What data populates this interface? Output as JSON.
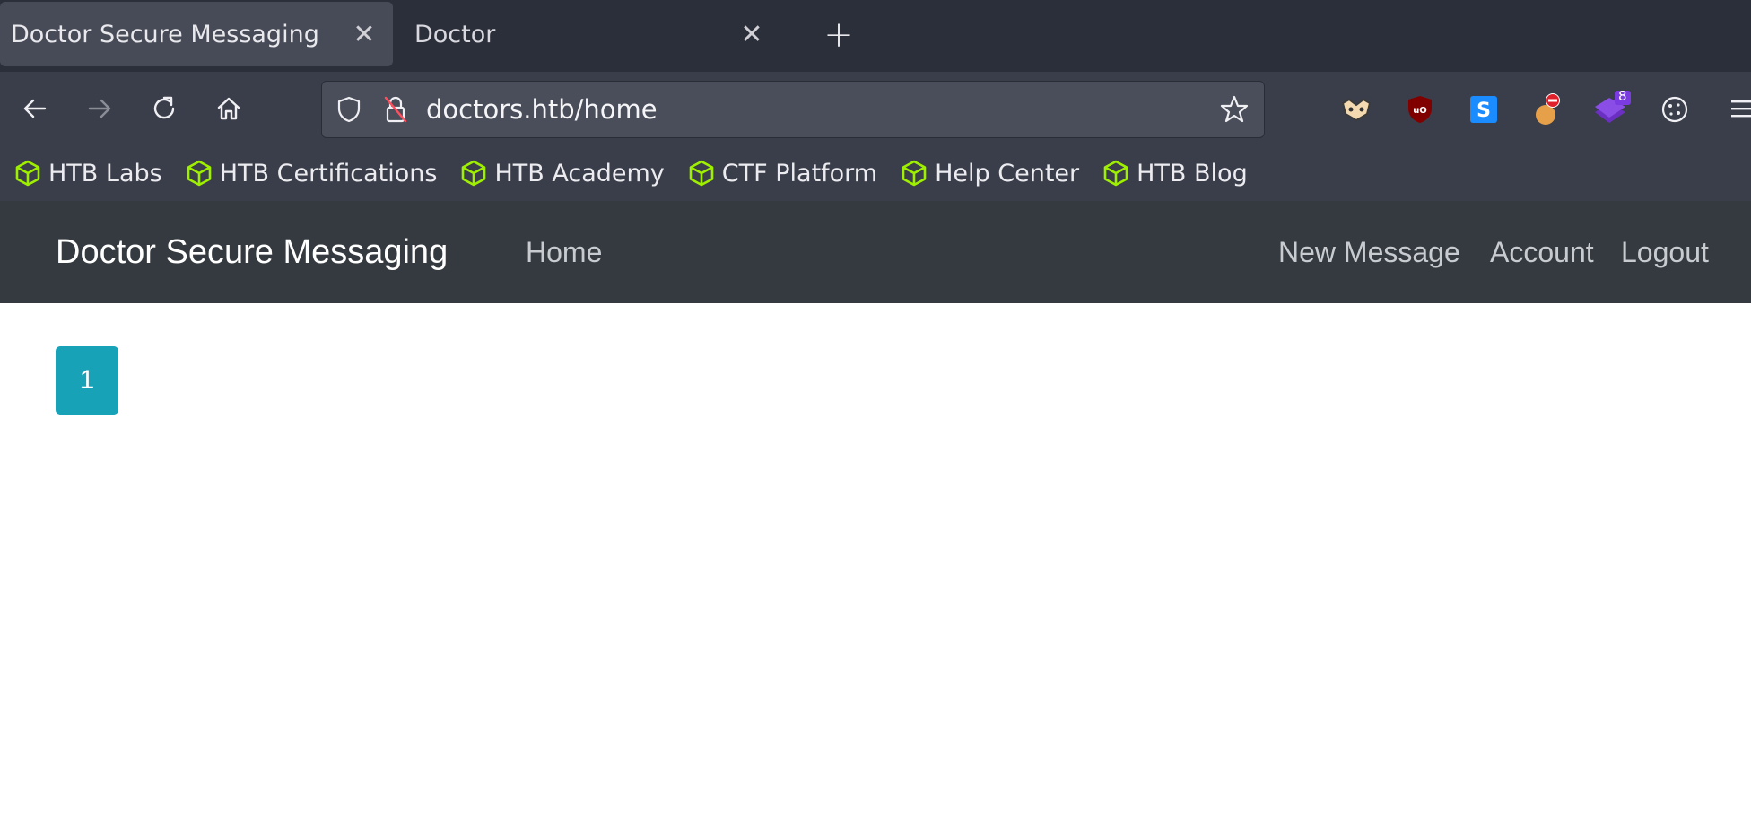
{
  "browser": {
    "tabs": [
      {
        "title": "Doctor Secure Messaging",
        "active": true
      },
      {
        "title": "Doctor",
        "active": false
      }
    ],
    "url": "doctors.htb/home",
    "extensions": {
      "badge_count": "8"
    },
    "bookmarks": [
      "HTB Labs",
      "HTB Certifications",
      "HTB Academy",
      "CTF Platform",
      "Help Center",
      "HTB Blog"
    ],
    "colors": {
      "bookmark_icon": "#9fef00"
    }
  },
  "site": {
    "brand": "Doctor Secure Messaging",
    "nav": {
      "home": "Home",
      "new_message": "New Message",
      "account": "Account",
      "logout": "Logout"
    },
    "pagination": {
      "current": "1"
    },
    "colors": {
      "navbar_bg": "#343a40",
      "page_button": "#17a2b8"
    }
  }
}
